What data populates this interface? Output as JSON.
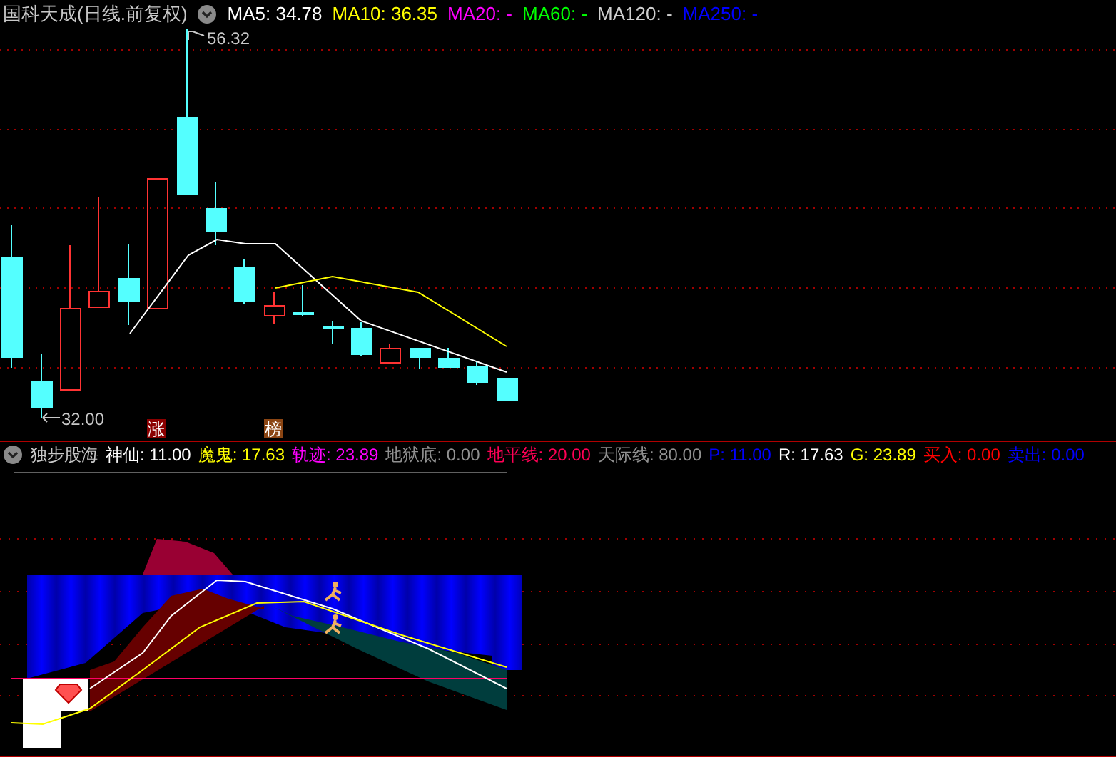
{
  "price_panel": {
    "title": "国科天成(日线.前复权)",
    "indicators": [
      {
        "text": "MA5: 34.78",
        "color": "#ffffff"
      },
      {
        "text": "MA10: 36.35",
        "color": "#ffff00"
      },
      {
        "text": "MA20: -",
        "color": "#ff00ff"
      },
      {
        "text": "MA60: -",
        "color": "#00ff00"
      },
      {
        "text": "MA120: -",
        "color": "#d0d0d0"
      },
      {
        "text": "MA250: -",
        "color": "#0000ff"
      }
    ],
    "high_label": "56.32",
    "low_label": "32.00",
    "markers": [
      {
        "text": "涨",
        "color": "#8b0000"
      },
      {
        "text": "榜",
        "color": "#8b4513"
      }
    ]
  },
  "indicator_panel": {
    "name": "独步股海",
    "values": [
      {
        "text": "神仙: 11.00",
        "color": "#ffffff"
      },
      {
        "text": "魔鬼: 17.63",
        "color": "#ffff00"
      },
      {
        "text": "轨迹: 23.89",
        "color": "#ff00ff"
      },
      {
        "text": "地狱底: 0.00",
        "color": "#909090"
      },
      {
        "text": "地平线: 20.00",
        "color": "#ff0055"
      },
      {
        "text": "天际线: 80.00",
        "color": "#909090"
      },
      {
        "text": "P: 11.00",
        "color": "#0000ff"
      },
      {
        "text": "R: 17.63",
        "color": "#ffffff"
      },
      {
        "text": "G: 23.89",
        "color": "#ffff00"
      },
      {
        "text": "买入: 0.00",
        "color": "#ff0000"
      },
      {
        "text": "卖出: 0.00",
        "color": "#0000ff"
      }
    ]
  }
}
